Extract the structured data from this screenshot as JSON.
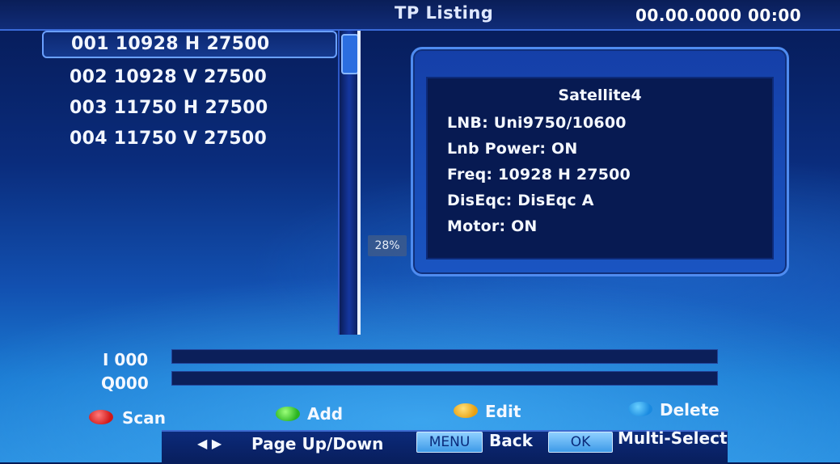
{
  "header": {
    "title": "TP Listing",
    "datetime": "00.00.0000 00:00"
  },
  "tp_list": [
    {
      "label": "001 10928 H 27500",
      "selected": true
    },
    {
      "label": "002 10928 V 27500",
      "selected": false
    },
    {
      "label": "003 11750 H 27500",
      "selected": false
    },
    {
      "label": "004 11750 V 27500",
      "selected": false
    }
  ],
  "progress_badge": "28%",
  "info": {
    "satellite": "Satellite4",
    "lnb": "LNB: Uni9750/10600",
    "lnb_power": "Lnb Power: ON",
    "freq": "Freq: 10928 H 27500",
    "diseqc": "DisEqc: DisEqc A",
    "motor": "Motor: ON"
  },
  "signal": {
    "i_label": "I 000",
    "q_label": "Q000",
    "i_value": 0,
    "q_value": 0
  },
  "color_keys": [
    {
      "label": "Scan",
      "color": "#d01818"
    },
    {
      "label": "Add",
      "color": "#2ab420"
    },
    {
      "label": "Edit",
      "color": "#e8a010"
    },
    {
      "label": "Delete",
      "color": "#1a8ae0"
    }
  ],
  "hints": {
    "arrows": "◀ ▶",
    "page": "Page Up/Down",
    "menu_key": "MENU",
    "back": "Back",
    "ok_key": "OK",
    "multi_select": "Multi-Select"
  }
}
